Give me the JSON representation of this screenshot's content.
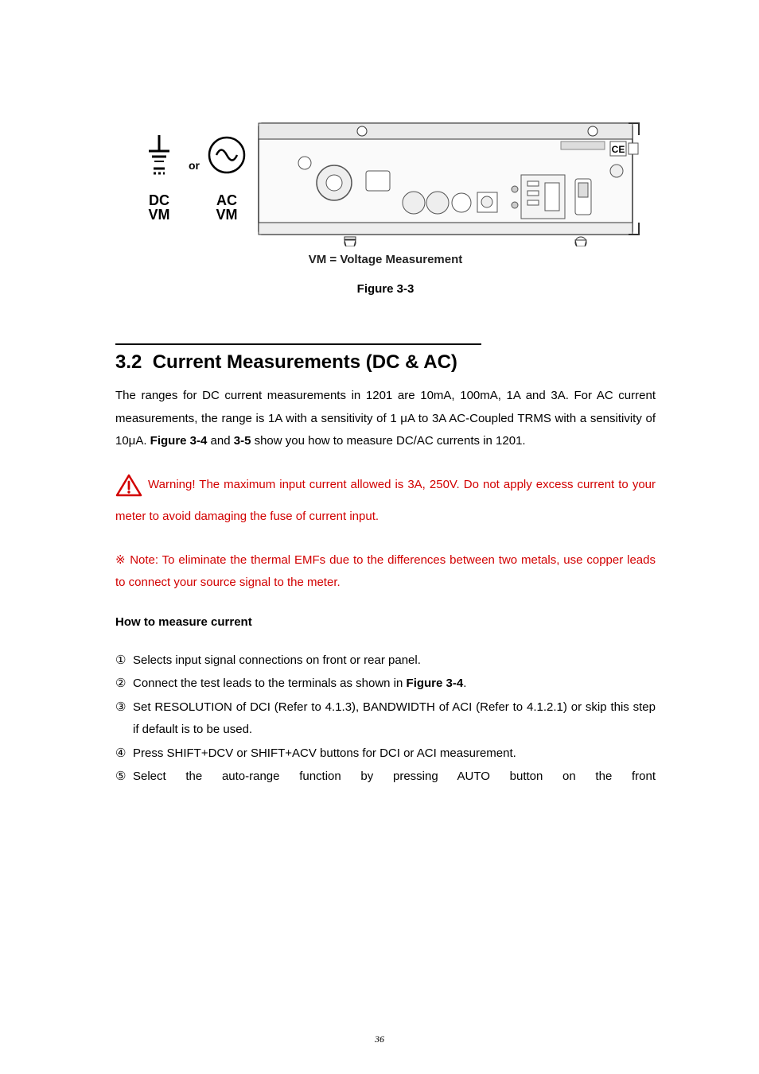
{
  "figure": {
    "vm_caption": "VM = Voltage Measurement",
    "label": "Figure 3-3",
    "symbols": {
      "dc": "DC",
      "ac": "AC",
      "vm1": "VM",
      "vm2": "VM",
      "or": "or"
    }
  },
  "section": {
    "number": "3.2",
    "title": "Current Measurements (DC & AC)"
  },
  "body": {
    "p1_a": "The ranges for DC current measurements in 1201 are 10mA, 100mA, 1A and 3A. For AC current measurements, the range is 1A with a sensitivity of 1 μA to 3A AC-Coupled TRMS with a sensitivity of 10μA. ",
    "p1_b": "Figure 3-4",
    "p1_c": " and ",
    "p1_d": "3-5",
    "p1_e": " show you how to measure DC/AC currents in 1201."
  },
  "warning": {
    "text": " Warning! The maximum input current allowed is 3A, 250V. Do not apply excess current to your meter to avoid damaging the fuse of current input."
  },
  "note": {
    "text": "※ Note: To eliminate the thermal EMFs due to the differences between two metals, use copper leads to connect your source signal to the meter."
  },
  "subheading": "How to measure current",
  "steps": {
    "n1": "①",
    "s1": "Selects input signal connections on front or rear panel.",
    "n2": "②",
    "s2a": "Connect the test leads to the terminals as shown in ",
    "s2b": "Figure 3-4",
    "s2c": ".",
    "n3": "③",
    "s3": "Set RESOLUTION of DCI (Refer to 4.1.3), BANDWIDTH of ACI (Refer to 4.1.2.1) or skip this step if default is to be used.",
    "n4": "④",
    "s4": "Press SHIFT+DCV or SHIFT+ACV buttons for DCI or ACI measurement.",
    "n5": "⑤",
    "s5": "Select the auto-range function by pressing AUTO button on the front"
  },
  "page_number": "36"
}
